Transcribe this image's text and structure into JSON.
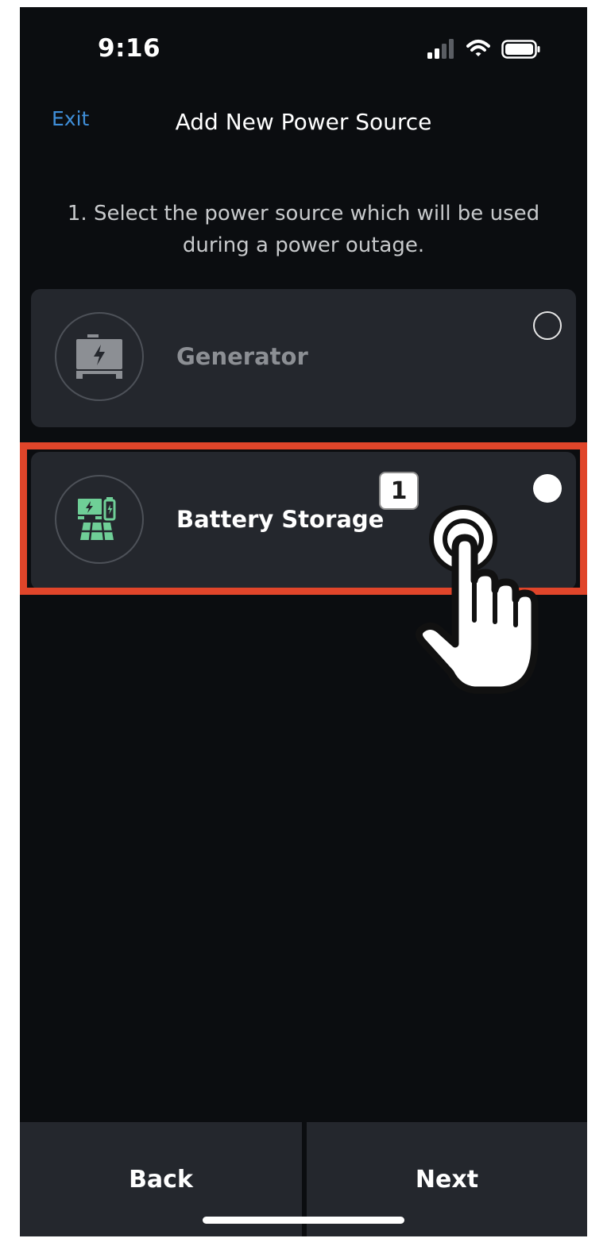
{
  "status_bar": {
    "time": "9:16",
    "icons": [
      "cellular-signal-icon",
      "wifi-icon",
      "battery-icon"
    ]
  },
  "header": {
    "exit_label": "Exit",
    "title": "Add New Power Source"
  },
  "instruction": "1. Select the power source which will be used during a power outage.",
  "options": [
    {
      "label": "Generator",
      "icon": "generator-icon",
      "selected": false
    },
    {
      "label": "Battery Storage",
      "icon": "battery-storage-icon",
      "selected": true
    }
  ],
  "step_badge": "1",
  "footer": {
    "back_label": "Back",
    "next_label": "Next"
  },
  "colors": {
    "background": "#0b0d10",
    "card": "#24272d",
    "accent_link": "#3f8ed8",
    "highlight": "#e0452a",
    "icon_green": "#6fcf97"
  }
}
